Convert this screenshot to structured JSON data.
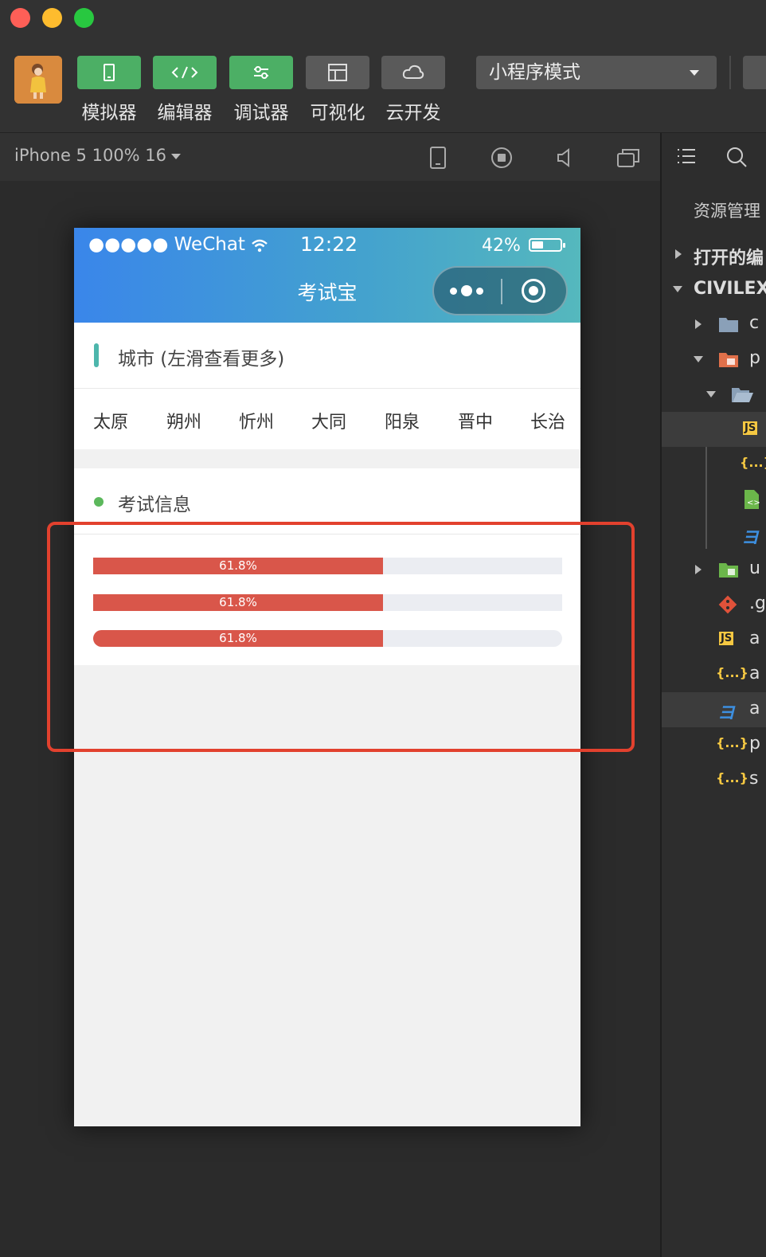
{
  "toolbar": {
    "tools": [
      {
        "label": "模拟器",
        "icon": "phone-icon",
        "color": "#4caf65"
      },
      {
        "label": "编辑器",
        "icon": "code-icon",
        "color": "#4caf65"
      },
      {
        "label": "调试器",
        "icon": "debug-icon",
        "color": "#4caf65"
      },
      {
        "label": "可视化",
        "icon": "layout-icon",
        "color": "#5a5a5a"
      },
      {
        "label": "云开发",
        "icon": "cloud-icon",
        "color": "#5a5a5a"
      }
    ],
    "mode": "小程序模式"
  },
  "subbar": {
    "device": "iPhone 5 100% 16"
  },
  "phone": {
    "status": {
      "carrier": "●●●●● WeChat",
      "time": "12:22",
      "battery": "42%",
      "battery_level": 0.42
    },
    "title": "考试宝",
    "city_header": "城市 (左滑查看更多)",
    "cities": [
      "太原",
      "朔州",
      "忻州",
      "大同",
      "阳泉",
      "晋中",
      "长治"
    ],
    "info_header": "考试信息",
    "progress": [
      {
        "text": "61.8%",
        "value": 0.618,
        "rounded": false
      },
      {
        "text": "61.8%",
        "value": 0.618,
        "rounded": false
      },
      {
        "text": "61.8%",
        "value": 0.618,
        "rounded": true
      }
    ]
  },
  "explorer": {
    "header": "资源管理",
    "open_editors": "打开的编",
    "project": "CIVILEX",
    "items": [
      "c",
      "p",
      "",
      "",
      "",
      "",
      "",
      "u",
      ".g",
      "a",
      "a",
      "a",
      "p",
      "s"
    ]
  }
}
